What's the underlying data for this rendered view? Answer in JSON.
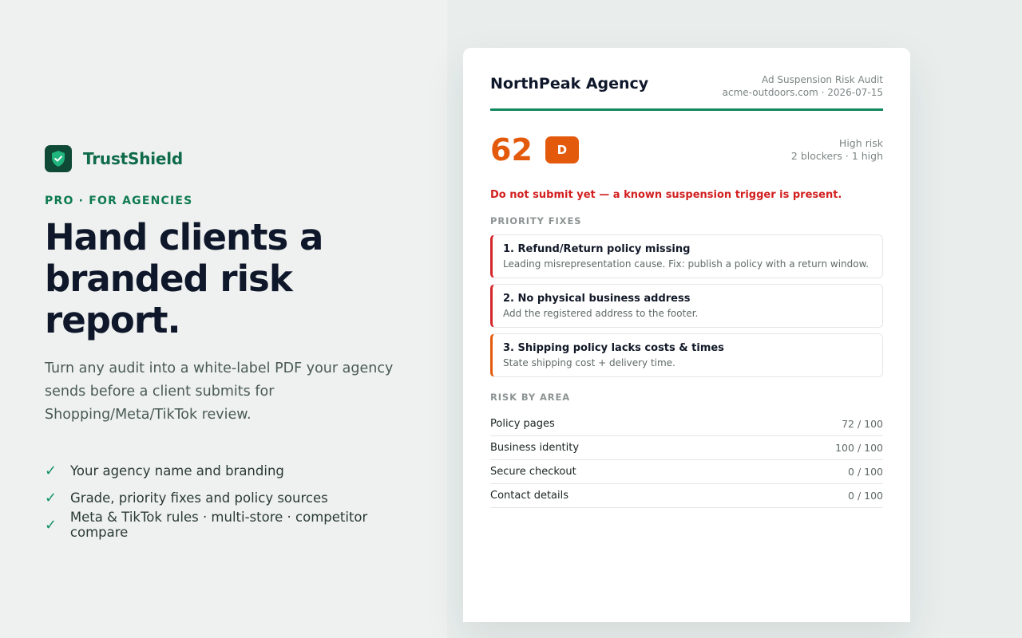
{
  "brand": {
    "name": "TrustShield",
    "logo_icon": "shield-check-icon",
    "logo_color": "#0f4a36",
    "accent": "#0f7a52"
  },
  "hero": {
    "eyebrow": "PRO · FOR AGENCIES",
    "headline_line1": "Hand clients a",
    "headline_line2": "branded risk report.",
    "subtitle": "Turn any audit into a white-label PDF your agency sends before a client submits for Shopping/Meta/TikTok review."
  },
  "features": [
    "Your agency name and branding",
    "Grade, priority fixes and policy sources",
    "Meta & TikTok rules · multi-store · competitor compare"
  ],
  "report": {
    "agency": "NorthPeak Agency",
    "report_title": "Ad Suspension Risk Audit",
    "site_and_date": "acme-outdoors.com · 2026-07-15",
    "score": "62",
    "grade": "D",
    "risk_level": "High risk",
    "risk_counts": "2 blockers · 1 high",
    "warning": "Do not submit yet — a known suspension trigger is present.",
    "score_color": "#e35a0c",
    "warning_color": "#d21f1f",
    "priority_label": "PRIORITY FIXES",
    "fixes": [
      {
        "title": "1. Refund/Return policy missing",
        "desc": "Leading misrepresentation cause. Fix: publish a policy with a return window.",
        "severity": "blocker",
        "color": "#d5262a"
      },
      {
        "title": "2. No physical business address",
        "desc": "Add the registered address to the footer.",
        "severity": "blocker",
        "color": "#d5262a"
      },
      {
        "title": "3. Shipping policy lacks costs & times",
        "desc": "State shipping cost + delivery time.",
        "severity": "high",
        "color": "#e35a0c"
      }
    ],
    "area_label": "RISK BY AREA",
    "areas": [
      {
        "name": "Policy pages",
        "score": "72 / 100"
      },
      {
        "name": "Business identity",
        "score": "100 / 100"
      },
      {
        "name": "Secure checkout",
        "score": "0 / 100"
      },
      {
        "name": "Contact details",
        "score": "0 / 100"
      }
    ]
  }
}
